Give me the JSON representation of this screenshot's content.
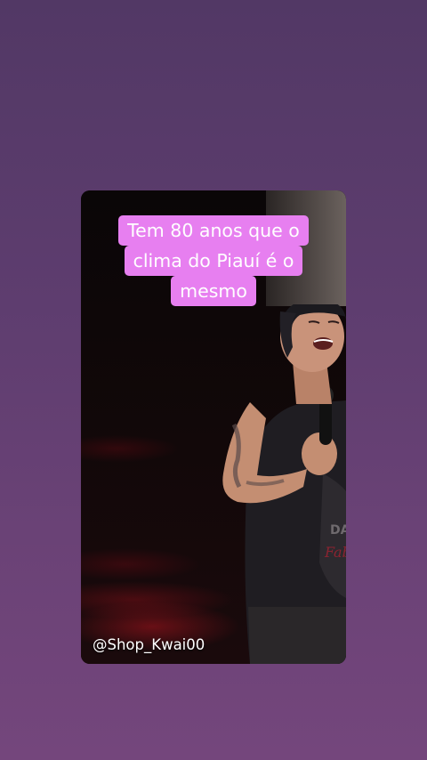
{
  "video": {
    "caption_lines": [
      "Tem 80 anos que o",
      "clima do Piauí é o",
      "mesmo"
    ],
    "watermark": "@Shop_Kwai00"
  },
  "colors": {
    "background": "#5e3d6f",
    "caption_background": "#e77ff0",
    "caption_text": "#ffffff"
  }
}
